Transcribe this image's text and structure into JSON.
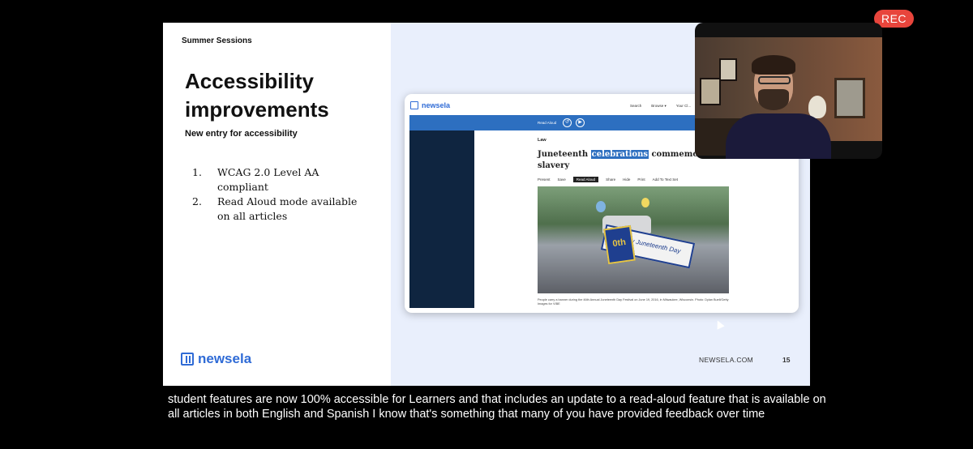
{
  "recording": {
    "label": "REC",
    "color": "#e8453c"
  },
  "slide": {
    "session_label": "Summer Sessions",
    "title_line1": "Accessibility",
    "title_line2": "improvements",
    "subtitle": "New entry for accessibility",
    "list": [
      {
        "num": "1.",
        "text": "WCAG 2.0 Level AA compliant"
      },
      {
        "num": "2.",
        "text": "Read Aloud mode available on all articles"
      }
    ],
    "brand": "newsela",
    "website": "NEWSELA.COM",
    "page_number": "15",
    "brand_color": "#2f6bd6"
  },
  "article": {
    "logo": "newsela",
    "nav": [
      "Search",
      "Browse ▾",
      "Your Cl..."
    ],
    "read_aloud_label": "Read Aloud",
    "category": "Law",
    "headline_pre": "Juneteenth ",
    "headline_highlight": "celebrations",
    "headline_post": " commemorate end to slavery",
    "toolbar": [
      "Present",
      "Save",
      "Read Aloud",
      "Share",
      "Hide",
      "Print",
      "Add To Text Set"
    ],
    "toolbar_active": "Read Aloud",
    "photo_banner": "Happy Juneteenth Day",
    "photo_sign": "0th",
    "caption": "People carry a banner during the 46th Annual Juneteenth Day Festival on June 19, 2016, in Milwaukee, Wisconsin. Photo: Dylan Buell/Getty Images for VIBE"
  },
  "captions": {
    "line1": "student features are now 100% accessible for Learners and that includes an update to a read-aloud feature that is available on",
    "line2": "all articles in both English and Spanish I know that's something that many of you have provided feedback over time"
  }
}
